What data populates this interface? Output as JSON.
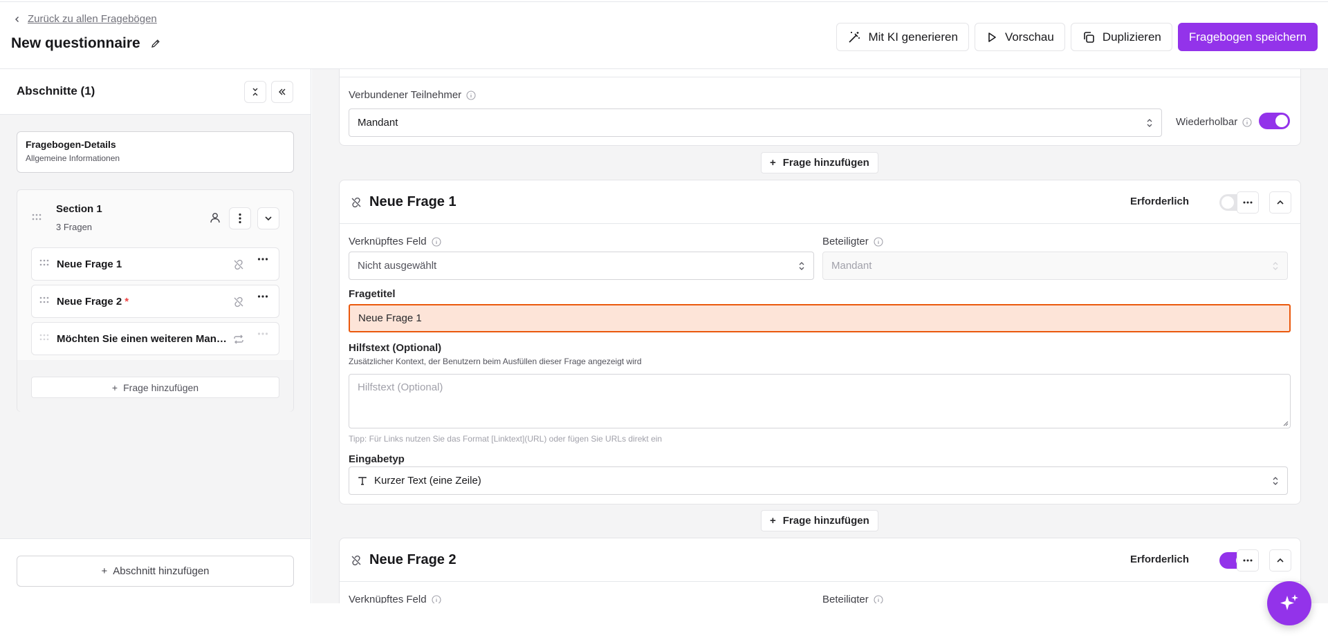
{
  "header": {
    "back_label": "Zurück zu allen Fragebögen",
    "title": "New questionnaire",
    "actions": {
      "ai_label": "Mit KI generieren",
      "preview_label": "Vorschau",
      "duplicate_label": "Duplizieren",
      "save_label": "Fragebogen speichern"
    }
  },
  "sidebar": {
    "title": "Abschnitte (1)",
    "details": {
      "title": "Fragebogen-Details",
      "subtitle": "Allgemeine Informationen"
    },
    "section": {
      "name": "Section 1",
      "count": "3 Fragen",
      "questions": [
        {
          "label": "Neue Frage 1",
          "required": ""
        },
        {
          "label": "Neue Frage 2",
          "required": "*"
        },
        {
          "label": "Möchten Sie einen weiteren Mandanten hinzufügen?",
          "required": ""
        }
      ],
      "add_question_label": "Frage hinzufügen"
    },
    "add_section_label": "Abschnitt hinzufügen"
  },
  "main": {
    "top_card": {
      "participant_label": "Verbundener Teilnehmer",
      "participant_value": "Mandant",
      "repeatable_label": "Wiederholbar",
      "repeatable_on": true
    },
    "add_question_label": "Frage hinzufügen",
    "question1": {
      "title": "Neue Frage 1",
      "required_label": "Erforderlich",
      "required_on": false,
      "linked_field_label": "Verknüpftes Feld",
      "linked_field_value": "Nicht ausgewählt",
      "party_label": "Beteiligter",
      "party_value": "Mandant",
      "question_title_label": "Fragetitel",
      "question_title_value": "Neue Frage 1",
      "help_label": "Hilfstext (Optional)",
      "help_description": "Zusätzlicher Kontext, der Benutzern beim Ausfüllen dieser Frage angezeigt wird",
      "help_placeholder": "Hilfstext (Optional)",
      "help_tip": "Tipp: Für Links nutzen Sie das Format [Linktext](URL) oder fügen Sie URLs direkt ein",
      "input_type_label": "Eingabetyp",
      "input_type_value": "Kurzer Text (eine Zeile)"
    },
    "question2": {
      "title": "Neue Frage 2",
      "required_label": "Erforderlich",
      "required_on": true,
      "linked_field_label": "Verknüpftes Feld",
      "party_label": "Beteiligter"
    }
  },
  "colors": {
    "accent": "#9333ea",
    "error_bg": "#fde4d8",
    "error_border": "#ea580c",
    "required": "#ef4444"
  },
  "icons": [
    "chevron-left-icon",
    "pencil-icon",
    "magic-wand-icon",
    "play-icon",
    "copy-icon",
    "collapse-icon",
    "double-chevron-left-icon",
    "drag-handle-icon",
    "user-icon",
    "more-icon",
    "chevron-down-icon",
    "unlink-icon",
    "repeat-icon",
    "plus-icon",
    "info-icon",
    "text-type-icon",
    "sparkles-icon",
    "chevron-up-icon",
    "select-caret-icon"
  ]
}
